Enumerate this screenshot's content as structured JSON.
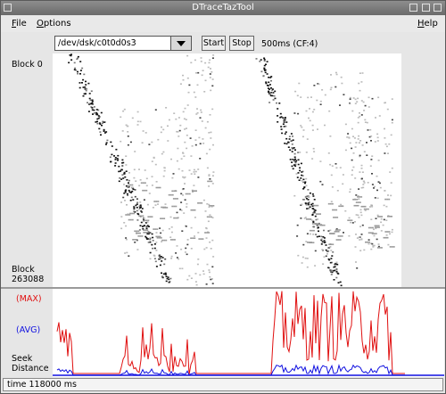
{
  "window": {
    "title": "DTraceTazTool"
  },
  "menubar": {
    "file": {
      "key": "F",
      "rest": "ile"
    },
    "options": {
      "key": "O",
      "rest": "ptions"
    },
    "help": {
      "key": "H",
      "rest": "elp"
    }
  },
  "toolbar": {
    "device": "/dev/dsk/c0t0d0s3",
    "start_label": "Start",
    "stop_label": "Stop",
    "interval": "500ms (CF:4)"
  },
  "labels": {
    "block_top": "Block 0",
    "block_bottom_1": "Block",
    "block_bottom_2": "263088",
    "max": "(MAX)",
    "avg": "(AVG)",
    "seek_1": "Seek",
    "seek_2": "Distance"
  },
  "status": {
    "text": "time 118000 ms"
  },
  "colors": {
    "max": "#e01010",
    "avg": "#1010e0"
  }
}
